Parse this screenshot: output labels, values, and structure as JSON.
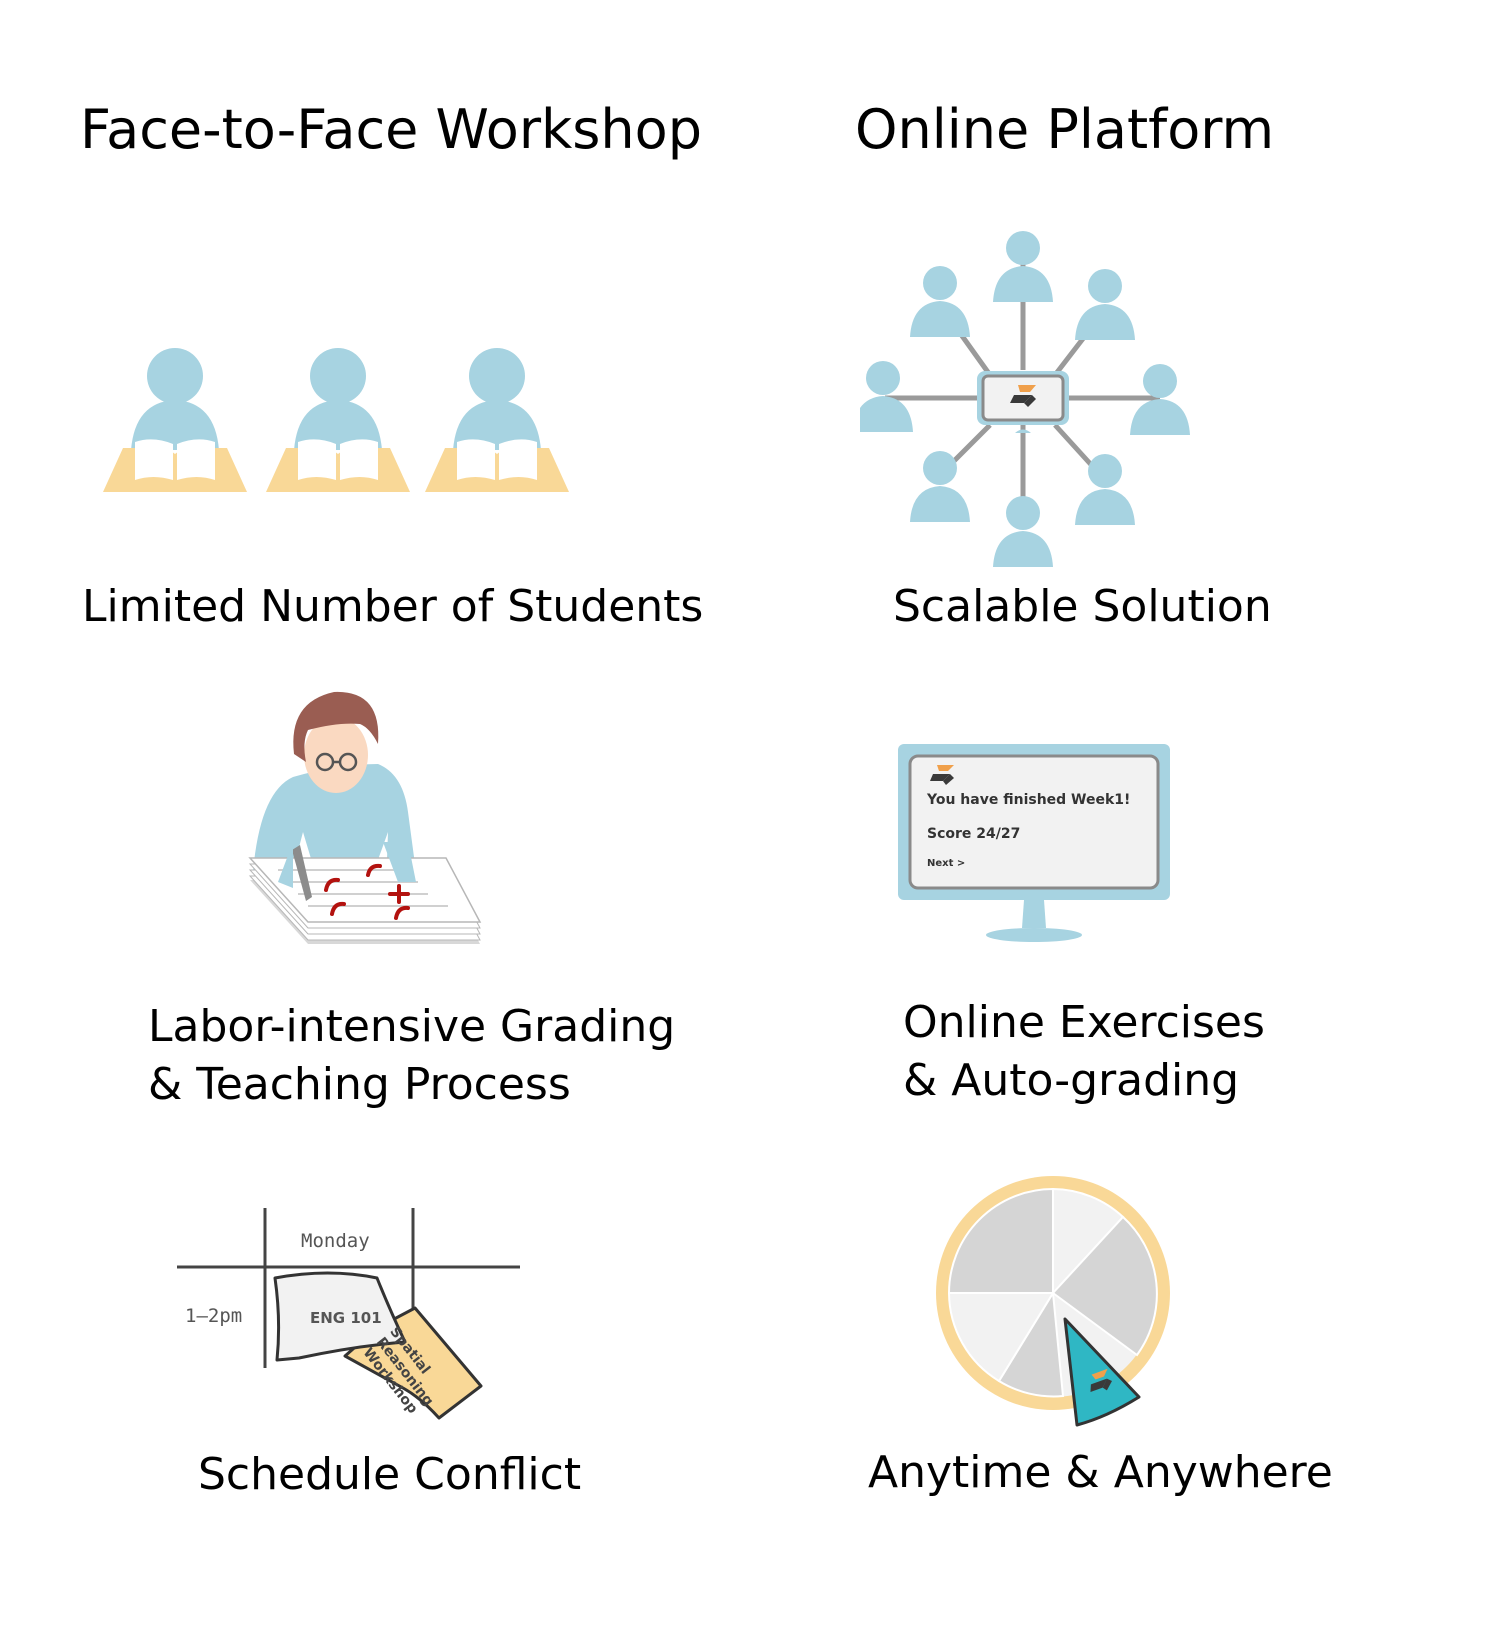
{
  "columns": {
    "left": {
      "title": "Face-to-Face  Workshop",
      "captions": {
        "students": "Limited Number of Students",
        "grading_line1": "Labor-intensive Grading",
        "grading_line2": "& Teaching Process",
        "schedule": "Schedule Conflict"
      },
      "schedule_graphic": {
        "day": "Monday",
        "time": "1–2pm",
        "course": "ENG 101",
        "workshop_line1": "Spatial",
        "workshop_line2": "Reasoning",
        "workshop_line3": "Workshop"
      }
    },
    "right": {
      "title": "Online Platform",
      "captions": {
        "scalable": "Scalable Solution",
        "exercises_line1": "Online Exercises",
        "exercises_line2": "& Auto-grading",
        "anytime": "Anytime & Anywhere"
      },
      "monitor_screen": {
        "message": "You have finished Week1!",
        "score": "Score 24/27",
        "next": "Next >"
      }
    }
  },
  "colors": {
    "person_blue": "#a7d3e1",
    "book_yellow": "#f9d897",
    "hair_brown": "#9a5d52",
    "skin": "#fad9c1",
    "mark_red": "#b3120f",
    "teal": "#2fb7c4",
    "logo_orange": "#f0a04b",
    "logo_dark": "#3a3a3a",
    "gray_line": "#9a9a9a"
  },
  "icons": [
    "person-icon",
    "open-book-icon",
    "monitor-icon",
    "logo-icon",
    "clock-icon",
    "pencil-icon",
    "glasses-icon"
  ]
}
